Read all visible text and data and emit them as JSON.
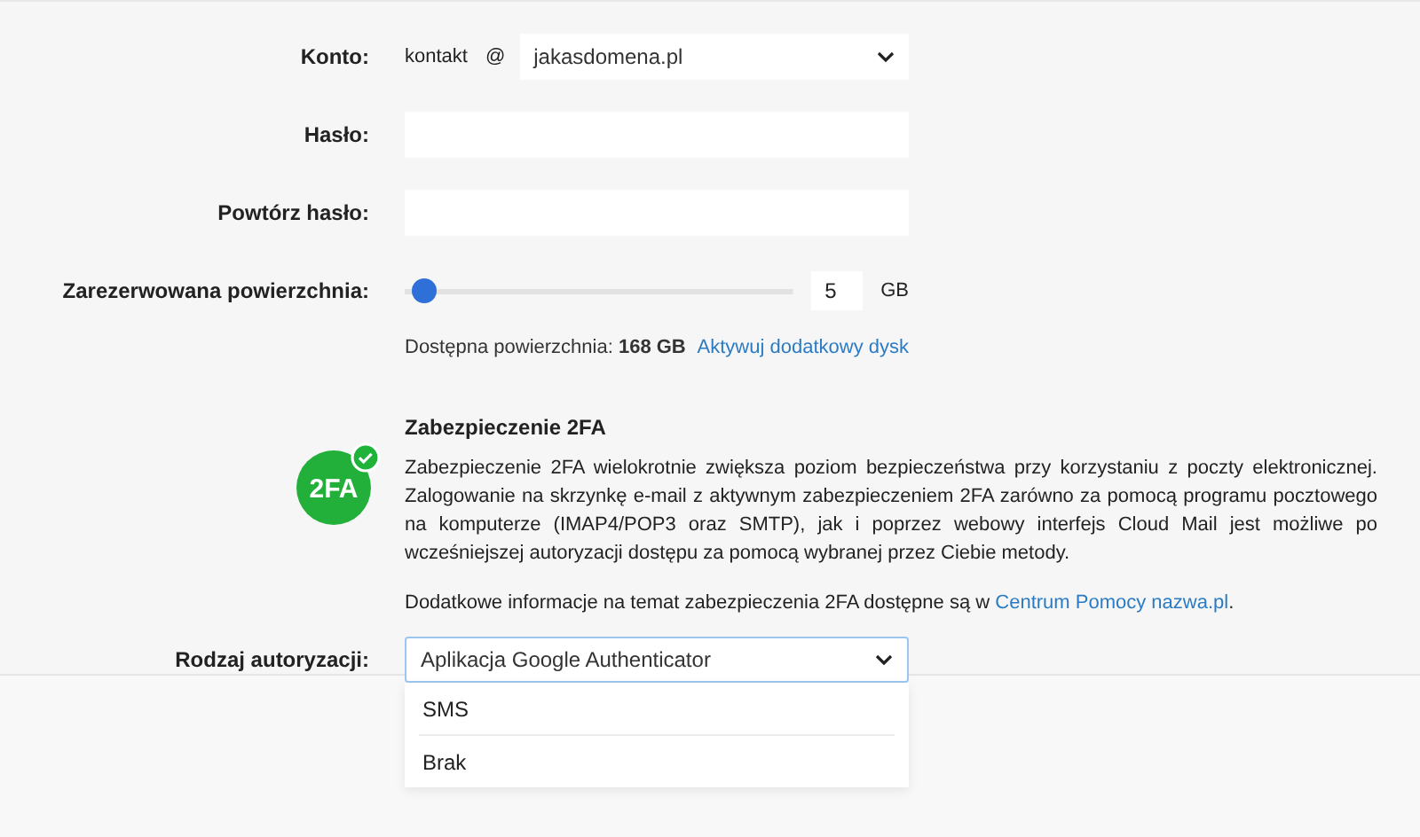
{
  "account": {
    "label": "Konto:",
    "local_part": "kontakt",
    "at": "@",
    "domain": "jakasdomena.pl"
  },
  "password": {
    "label": "Hasło:"
  },
  "repeat_password": {
    "label": "Powtórz hasło:"
  },
  "storage": {
    "label": "Zarezerwowana powierzchnia:",
    "level": 0.02,
    "value": "5",
    "unit": "GB",
    "available_label": "Dostępna powierzchnia:",
    "available_value": "168 GB",
    "link": "Aktywuj dodatkowy dysk"
  },
  "twofa": {
    "heading": "Zabezpieczenie 2FA",
    "badge": "2FA",
    "enabled": true,
    "description": "Zabezpieczenie 2FA wielokrotnie zwiększa poziom bezpieczeństwa przy korzystaniu z poczty elektronicznej. Zalogowanie na skrzynkę e-mail z aktywnym zabezpieczeniem 2FA zarówno za pomocą programu pocztowego na komputerze (IMAP4/POP3 oraz SMTP), jak i poprzez webowy interfejs Cloud Mail jest możliwe po wcześniejszej autoryzacji dostępu za pomocą wybranej przez Ciebie metody.",
    "info_text": "Dodatkowe informacje na temat zabezpieczenia 2FA dostępne są w",
    "info_link": "Centrum Pomocy nazwa.pl",
    "info_end": "."
  },
  "auth_type": {
    "label": "Rodzaj autoryzacji:",
    "value": "Aplikacja Google Authenticator",
    "expanded": true,
    "options": [
      {
        "label": "SMS"
      },
      {
        "label": "Brak"
      }
    ]
  }
}
